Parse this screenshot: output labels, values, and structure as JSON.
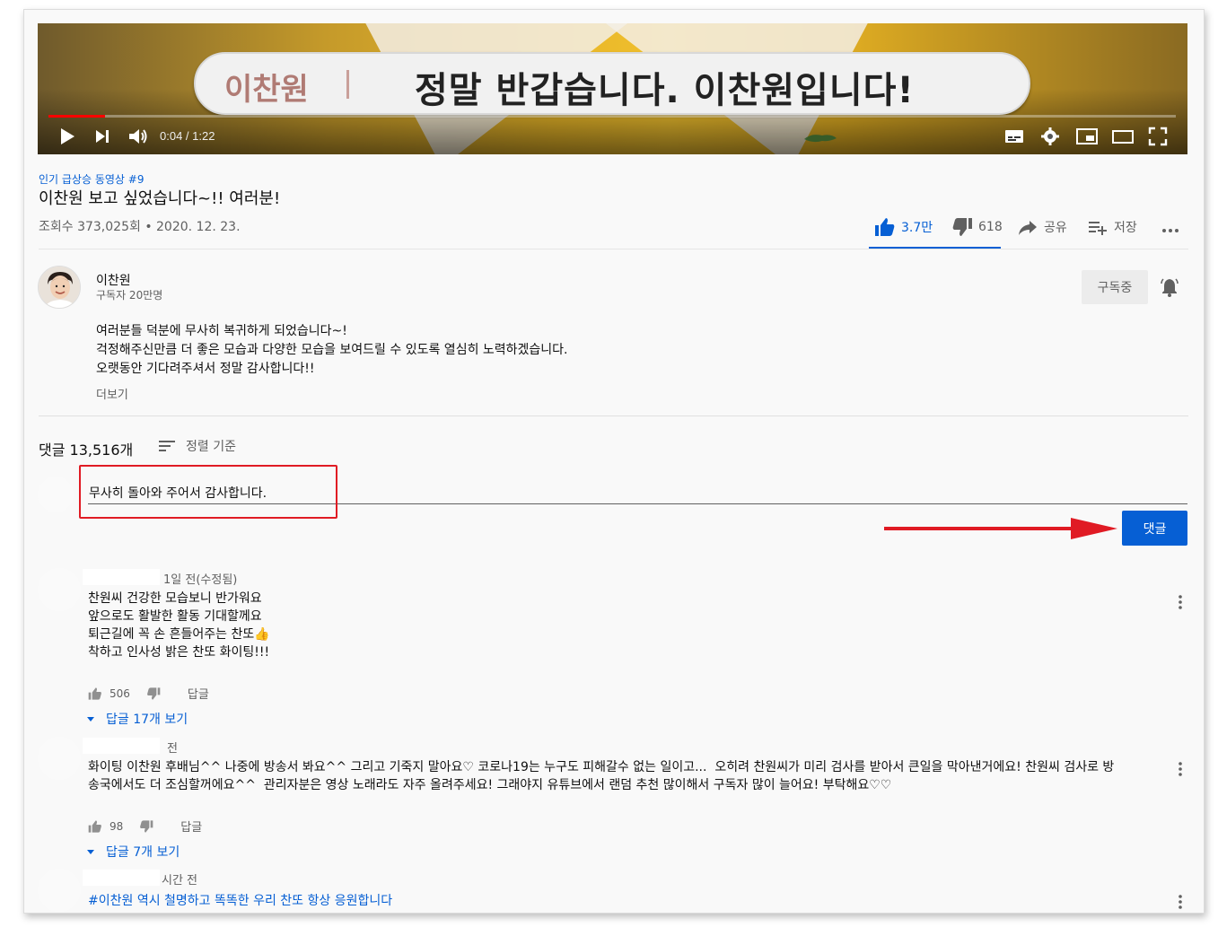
{
  "player": {
    "caption_name": "이찬원",
    "caption_text": "정말 반갑습니다. 이찬원입니다!",
    "time": "0:04 / 1:22",
    "progress": 0.05,
    "icons": [
      "play-icon",
      "next-icon",
      "volume-icon",
      "subtitles-icon",
      "settings-icon",
      "miniplayer-icon",
      "theater-icon",
      "fullscreen-icon"
    ]
  },
  "video": {
    "hashtag": "인기 급상승 동영상 #9",
    "title": "이찬원 보고 싶었습니다~!! 여러분!",
    "meta": "조회수 373,025회 • 2020. 12. 23.",
    "likes": "3.7만",
    "dislikes": "618",
    "share": "공유",
    "save": "저장"
  },
  "channel": {
    "name": "이찬원",
    "subscribers": "구독자 20만명",
    "subscribe_label": "구독중",
    "description": [
      "여러분들 덕분에 무사히 복귀하게 되었습니다~!",
      "걱정해주신만큼 더 좋은 모습과 다양한 모습을 보여드릴 수 있도록 열심히 노력하겠습니다.",
      "오랫동안 기다려주셔서 정말 감사합니다!!"
    ],
    "more_label": "더보기"
  },
  "comments_section": {
    "count": "댓글 13,516개",
    "sort_label": "정렬 기준",
    "input_value": "무사히 돌아와 주어서 감사합니다.",
    "post_label": "댓글"
  },
  "comments": [
    {
      "time": "1일 전(수정됨)",
      "text": "찬원씨 건강한 모습보니 반가워요\n앞으로도 활발한 활동 기대할께요\n퇴근길에 꼭 손 흔들어주는 찬또👍\n착하고 인사성 밝은 찬또 화이팅!!!",
      "likes": "506",
      "reply_label": "답글",
      "replies": "답글 17개 보기"
    },
    {
      "time": "전",
      "text": "화이팅 이찬원 후배님^^ 나중에 방송서 봐요^^ 그리고 기죽지 말아요♡ 코로나19는 누구도 피해갈수 없는 일이고...  오히려 찬원씨가 미리 검사를 받아서 큰일을 막아낸거에요! 찬원씨 검사로 방\n송국에서도 더 조심할꺼에요^^  관리자분은 영상 노래라도 자주 올려주세요! 그래야지 유튜브에서 랜덤 추천 많이해서 구독자 많이 늘어요! 부탁해요♡♡",
      "likes": "98",
      "reply_label": "답글",
      "replies": "답글 7개 보기"
    },
    {
      "time": "시간 전",
      "text": "#이찬원 역시 철명하고 똑똑한 우리 찬또 항상 응원합니다"
    }
  ]
}
